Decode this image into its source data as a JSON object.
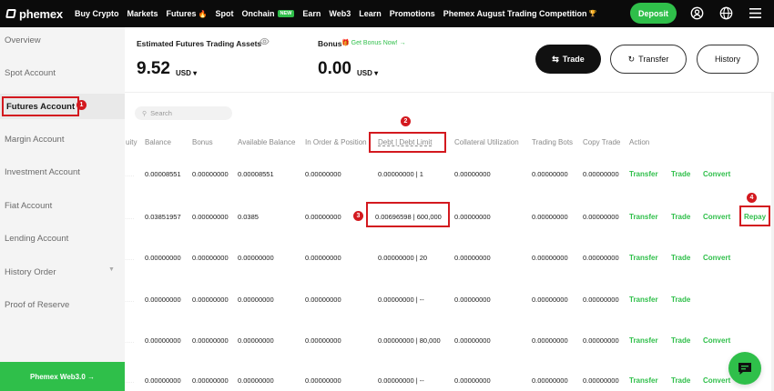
{
  "nav": {
    "logo": "phemex",
    "items": [
      "Buy Crypto",
      "Markets",
      "Futures",
      "Spot",
      "Onchain",
      "Earn",
      "Web3",
      "Learn",
      "Promotions",
      "Phemex August Trading Competition"
    ],
    "new_badge": "NEW",
    "deposit": "Deposit",
    "icons": [
      "account-icon",
      "globe-icon",
      "menu-icon"
    ]
  },
  "sidebar": {
    "items": [
      "Overview",
      "Spot Account",
      "Futures Account",
      "Margin Account",
      "Investment Account",
      "Fiat Account",
      "Lending Account",
      "History Order",
      "Proof of Reserve"
    ],
    "active": "Futures Account",
    "web3_button": "Phemex Web3.0 →"
  },
  "markers": [
    "1",
    "2",
    "3",
    "4"
  ],
  "header": {
    "assets_label": "Estimated Futures Trading Assets",
    "assets_value": "9.52",
    "assets_unit": "USD",
    "bonus_label": "Bonus",
    "bonus_link": "Get Bonus Now!",
    "bonus_value": "0.00",
    "bonus_unit": "USD",
    "trade_btn": "Trade",
    "transfer_btn": "Transfer",
    "history_btn": "History"
  },
  "search": {
    "placeholder": "Search"
  },
  "table": {
    "headers": [
      "uity",
      "Balance",
      "Bonus",
      "Available Balance",
      "In Order & Position",
      "Debt | Debt Limit",
      "Collateral Utilization",
      "Trading Bots",
      "Copy Trade",
      "Action"
    ],
    "rows": [
      {
        "balance": "0.00008551",
        "bonus": "0.00000000",
        "available": "0.00008551",
        "in_order": "0.00000000",
        "debt": "0.00000000 | 1",
        "collateral": "0.00000000",
        "bots": "0.00000000",
        "copy": "0.00000000",
        "actions": [
          "Transfer",
          "Trade",
          "Convert"
        ]
      },
      {
        "balance": "0.03851957",
        "bonus": "0.00000000",
        "available": "0.0385",
        "in_order": "0.00000000",
        "debt": "0.00696598 | 600,000",
        "collateral": "0.00000000",
        "bots": "0.00000000",
        "copy": "0.00000000",
        "actions": [
          "Transfer",
          "Trade",
          "Convert",
          "Repay"
        ]
      },
      {
        "balance": "0.00000000",
        "bonus": "0.00000000",
        "available": "0.00000000",
        "in_order": "0.00000000",
        "debt": "0.00000000 | 20",
        "collateral": "0.00000000",
        "bots": "0.00000000",
        "copy": "0.00000000",
        "actions": [
          "Transfer",
          "Trade",
          "Convert"
        ]
      },
      {
        "balance": "0.00000000",
        "bonus": "0.00000000",
        "available": "0.00000000",
        "in_order": "0.00000000",
        "debt": "0.00000000 | --",
        "collateral": "0.00000000",
        "bots": "0.00000000",
        "copy": "0.00000000",
        "actions": [
          "Transfer",
          "Trade"
        ]
      },
      {
        "balance": "0.00000000",
        "bonus": "0.00000000",
        "available": "0.00000000",
        "in_order": "0.00000000",
        "debt": "0.00000000 | 80,000",
        "collateral": "0.00000000",
        "bots": "0.00000000",
        "copy": "0.00000000",
        "actions": [
          "Transfer",
          "Trade",
          "Convert"
        ]
      },
      {
        "balance": "0.00000000",
        "bonus": "0.00000000",
        "available": "0.00000000",
        "in_order": "0.00000000",
        "debt": "0.00000000 | --",
        "collateral": "0.00000000",
        "bots": "0.00000000",
        "copy": "0.00000000",
        "actions": [
          "Transfer",
          "Trade",
          "Convert"
        ]
      }
    ]
  },
  "colors": {
    "accent": "#2fbf4a",
    "highlight": "#d3191f",
    "topbar": "#0b0b0b",
    "sidebar": "#f4f4f4"
  }
}
